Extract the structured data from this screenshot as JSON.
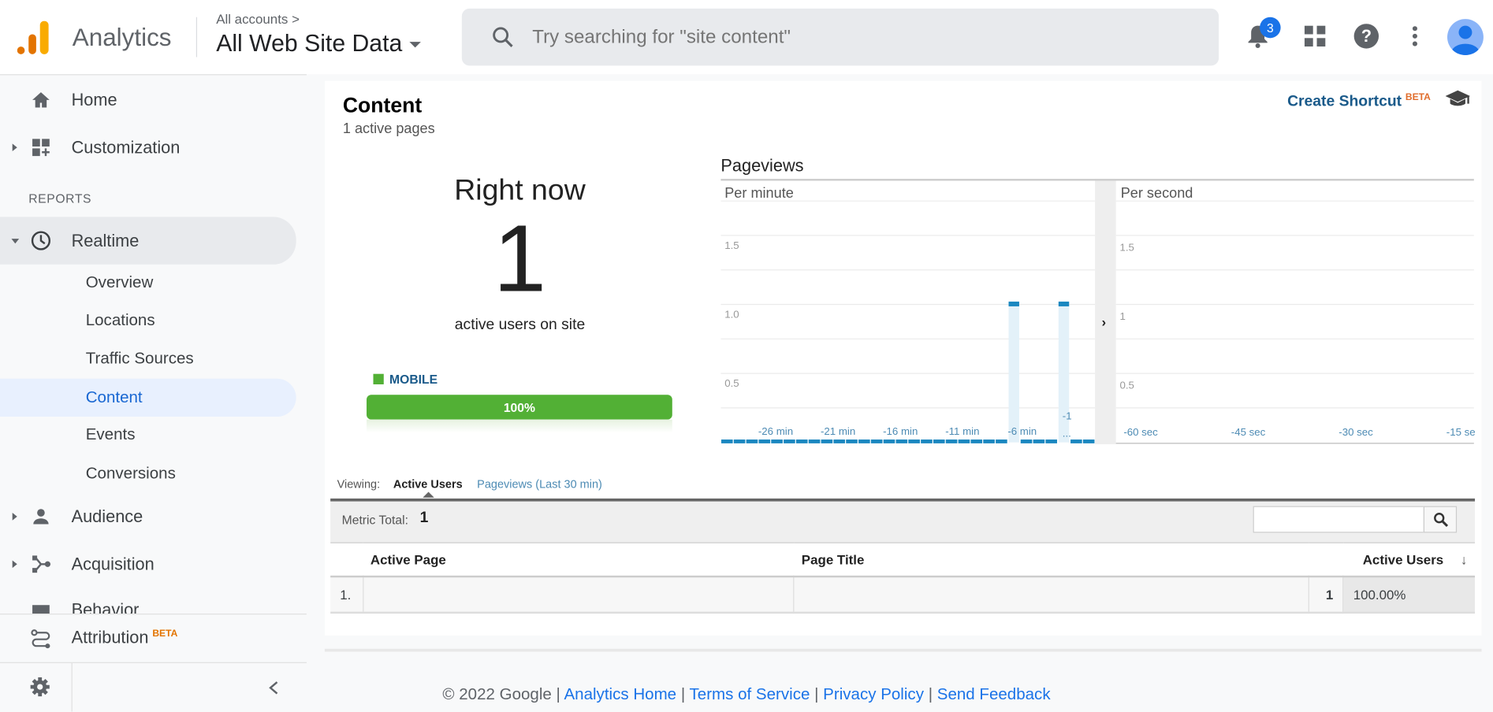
{
  "header": {
    "brand": "Analytics",
    "breadcrumb": "All accounts >",
    "property": "All Web Site Data",
    "search_placeholder": "Try searching for \"site content\"",
    "notification_count": "3",
    "icons": [
      "bell-icon",
      "apps-icon",
      "help-icon",
      "more-vert-icon",
      "avatar"
    ]
  },
  "sidebar": {
    "home": "Home",
    "customization": "Customization",
    "section": "REPORTS",
    "realtime": "Realtime",
    "realtime_items": [
      "Overview",
      "Locations",
      "Traffic Sources",
      "Content",
      "Events",
      "Conversions"
    ],
    "active_item": "Content",
    "audience": "Audience",
    "acquisition": "Acquisition",
    "behavior": "Behavior",
    "attribution": "Attribution",
    "attribution_badge": "BETA"
  },
  "content": {
    "title": "Content",
    "subtitle": "1 active pages",
    "shortcut": "Create Shortcut",
    "shortcut_badge": "BETA",
    "right_now": "Right now",
    "active_count": "1",
    "active_label": "active users on site",
    "device": "MOBILE",
    "device_pct_label": "100%",
    "device_pct": 100,
    "device_color": "#52b035"
  },
  "chart_data": [
    {
      "type": "bar",
      "title": "Pageviews",
      "subtitle": "Per minute",
      "x": [
        -29,
        -28,
        -27,
        -26,
        -25,
        -24,
        -23,
        -22,
        -21,
        -20,
        -19,
        -18,
        -17,
        -16,
        -15,
        -14,
        -13,
        -12,
        -11,
        -10,
        -9,
        -8,
        -7,
        -6,
        -5,
        -4,
        -3,
        -2,
        -1,
        0
      ],
      "values": [
        0,
        0,
        0,
        0,
        0,
        0,
        0,
        0,
        0,
        0,
        0,
        0,
        0,
        0,
        0,
        0,
        0,
        0,
        0,
        0,
        0,
        0,
        0,
        1,
        0,
        0,
        0,
        1,
        0,
        0
      ],
      "x_tick_labels": [
        "-26 min",
        "-21 min",
        "-16 min",
        "-11 min",
        "-6 min",
        "-1 ..."
      ],
      "y_tick_labels": [
        "0.5",
        "1.0",
        "1.5"
      ],
      "ylim": [
        0,
        2
      ],
      "color": "#1a87c0"
    },
    {
      "type": "bar",
      "subtitle": "Per second",
      "x_tick_labels": [
        "-60 sec",
        "-45 sec",
        "-30 sec",
        "-15 sec"
      ],
      "y_tick_labels": [
        "0.5",
        "1",
        "1.5"
      ],
      "values": [],
      "ylim": [
        0,
        2
      ]
    }
  ],
  "table": {
    "viewing_label": "Viewing:",
    "tabs": [
      "Active Users",
      "Pageviews (Last 30 min)"
    ],
    "active_tab": "Active Users",
    "metric_total_label": "Metric Total:",
    "metric_total": "1",
    "columns": [
      "Active Page",
      "Page Title",
      "Active Users"
    ],
    "rows": [
      {
        "index": "1.",
        "page": "",
        "title": "",
        "users": "1",
        "pct": "100.00%"
      }
    ]
  },
  "footer": {
    "copyright": "© 2022 Google",
    "links": [
      "Analytics Home",
      "Terms of Service",
      "Privacy Policy",
      "Send Feedback"
    ]
  }
}
